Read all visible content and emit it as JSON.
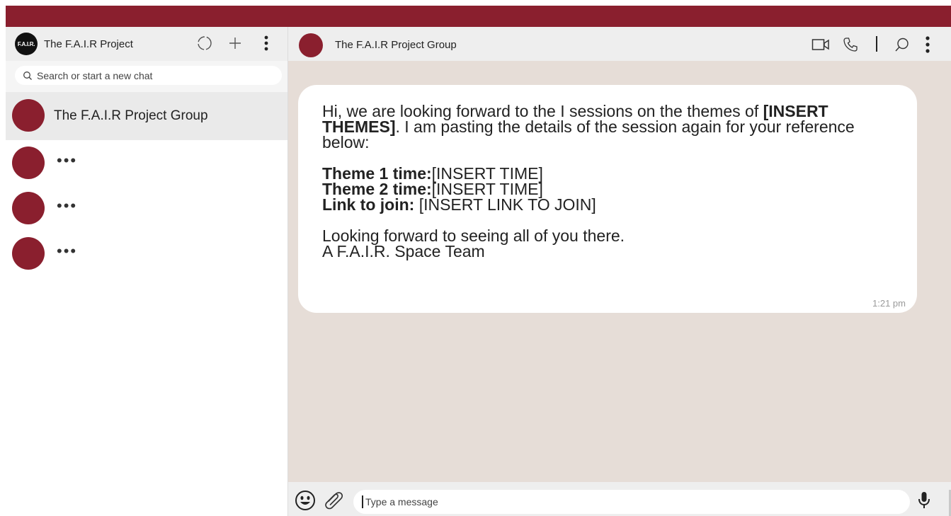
{
  "colors": {
    "brand": "#8a1f2e",
    "chat_bg": "#e6ddd7",
    "header_bg": "#eeeeee"
  },
  "sidebar": {
    "logo_text": "F.A.I.R.",
    "title": "The F.A.I.R Project",
    "icons": [
      "status-icon",
      "new-chat-icon",
      "menu-icon"
    ],
    "search_placeholder": "Search or start a new chat",
    "chats": [
      {
        "name": "The F.A.I.R Project Group",
        "active": true
      },
      {
        "name": "•••",
        "active": false
      },
      {
        "name": "•••",
        "active": false
      },
      {
        "name": "•••",
        "active": false
      }
    ]
  },
  "conversation": {
    "title": "The F.A.I.R Project Group",
    "icons": [
      "video-call-icon",
      "phone-icon",
      "search-icon",
      "menu-icon"
    ],
    "message": {
      "intro_1": "Hi, we are looking forward to the I sessions on the themes of ",
      "intro_bold": "[INSERT THEMES]",
      "intro_2": ". I am pasting the details of the session again for your reference below:",
      "theme1_label": "Theme 1 time:",
      "theme1_value": "[INSERT TIME]",
      "theme2_label": "Theme 2 time:",
      "theme2_value": "[INSERT TIME]",
      "link_label": "Link to join:",
      "link_value": " [INSERT LINK TO JOIN]",
      "closing_1": "Looking forward to seeing all of you there.",
      "closing_2": "A F.A.I.R. Space Team",
      "time": "1:21 pm"
    },
    "composer": {
      "placeholder": "Type a message",
      "icons": [
        "emoji-icon",
        "attach-icon",
        "microphone-icon"
      ]
    }
  }
}
